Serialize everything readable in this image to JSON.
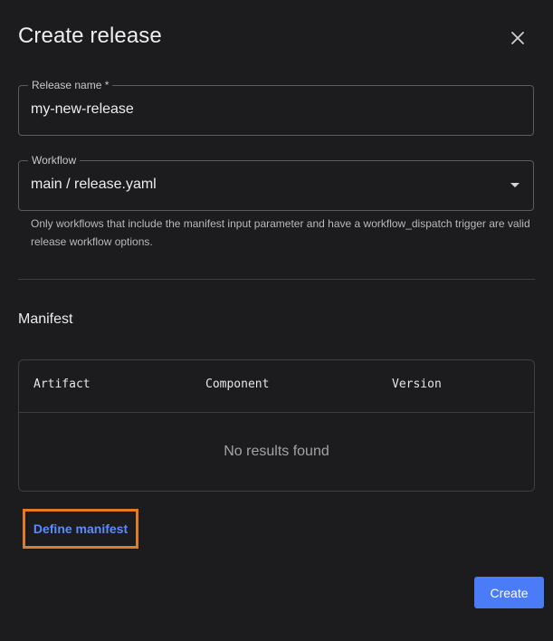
{
  "dialog": {
    "title": "Create release",
    "close_icon": "close-icon"
  },
  "release_name": {
    "label": "Release name *",
    "value": "my-new-release"
  },
  "workflow": {
    "label": "Workflow",
    "value": "main / release.yaml",
    "helper": "Only workflows that include the manifest input parameter and have a workflow_dispatch trigger are valid release workflow options.",
    "icon": "chevron-down-icon"
  },
  "manifest": {
    "title": "Manifest",
    "columns": [
      "Artifact",
      "Component",
      "Version"
    ],
    "empty_message": "No results found",
    "define_link": "Define manifest"
  },
  "actions": {
    "create_label": "Create"
  },
  "colors": {
    "accent": "#4a7cf7",
    "link": "#5b8bff",
    "highlight": "#e07c24",
    "background": "#1c1c1e"
  }
}
